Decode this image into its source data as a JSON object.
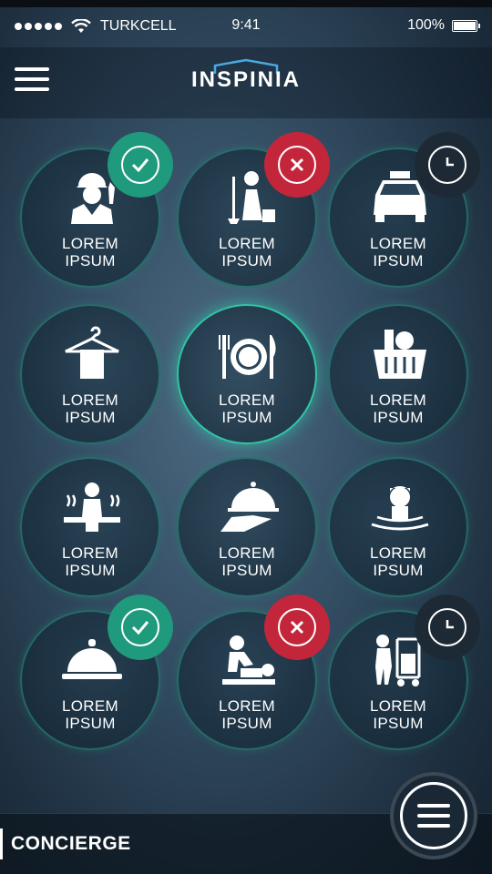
{
  "status_bar": {
    "carrier": "TURKCELL",
    "time": "9:41",
    "battery": "100%"
  },
  "header": {
    "logo_text": "INSPINIA",
    "menu_icon": "hamburger-icon"
  },
  "tiles": [
    {
      "label_1": "LOREM",
      "label_2": "IPSUM",
      "icon": "worker-icon",
      "badge": "check"
    },
    {
      "label_1": "LOREM",
      "label_2": "IPSUM",
      "icon": "housekeeping-icon",
      "badge": "close"
    },
    {
      "label_1": "LOREM",
      "label_2": "IPSUM",
      "icon": "taxi-icon",
      "badge": "clock"
    },
    {
      "label_1": "LOREM",
      "label_2": "IPSUM",
      "icon": "laundry-icon",
      "badge": ""
    },
    {
      "label_1": "LOREM",
      "label_2": "IPSUM",
      "icon": "restaurant-icon",
      "badge": ""
    },
    {
      "label_1": "LOREM",
      "label_2": "IPSUM",
      "icon": "shopping-basket-icon",
      "badge": ""
    },
    {
      "label_1": "LOREM",
      "label_2": "IPSUM",
      "icon": "sauna-icon",
      "badge": ""
    },
    {
      "label_1": "LOREM",
      "label_2": "IPSUM",
      "icon": "room-service-icon",
      "badge": ""
    },
    {
      "label_1": "LOREM",
      "label_2": "IPSUM",
      "icon": "spa-bath-icon",
      "badge": ""
    },
    {
      "label_1": "LOREM",
      "label_2": "IPSUM",
      "icon": "cloche-icon",
      "badge": "check"
    },
    {
      "label_1": "LOREM",
      "label_2": "IPSUM",
      "icon": "massage-icon",
      "badge": "close"
    },
    {
      "label_1": "LOREM",
      "label_2": "IPSUM",
      "icon": "bellboy-icon",
      "badge": "clock"
    }
  ],
  "footer": {
    "title": "CONCIERGE"
  },
  "colors": {
    "accent": "#33c3a5",
    "ok": "#1f9a7c",
    "error": "#c3263a",
    "pending": "#1d2a36"
  }
}
